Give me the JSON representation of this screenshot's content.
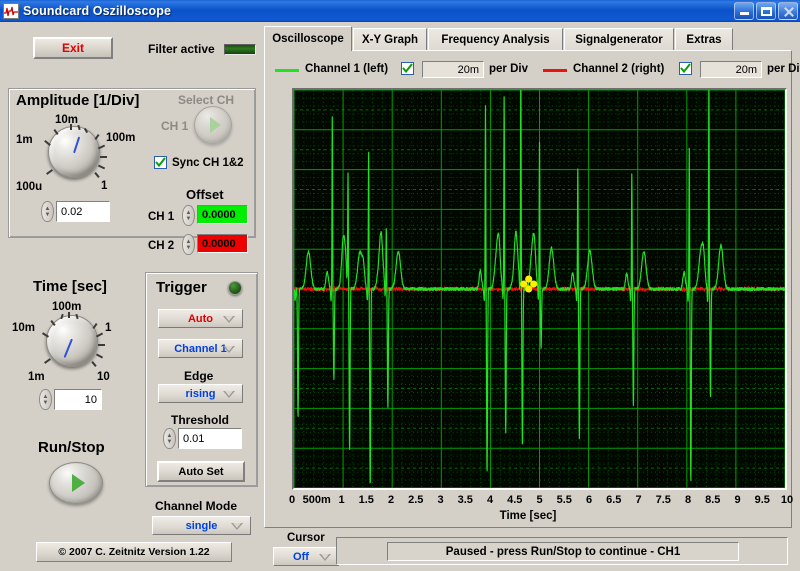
{
  "window": {
    "title": "Soundcard Oszilloscope",
    "icon": "waveform-icon",
    "buttons": {
      "minimize": "minimize-icon",
      "maximize": "maximize-icon",
      "close": "close-icon"
    }
  },
  "toolbar": {
    "exit_label": "Exit",
    "filter_label": "Filter active",
    "filter_state": "off"
  },
  "amplitude": {
    "title": "Amplitude [1/Div]",
    "knob_ticks": [
      "100u",
      "1m",
      "10m",
      "100m",
      "1"
    ],
    "value": "0.02",
    "select_ch_label": "Select CH",
    "ch_label": "CH 1",
    "sync_label": "Sync CH 1&2",
    "sync_checked": true,
    "offset_title": "Offset",
    "offset_ch1_label": "CH 1",
    "offset_ch1_value": "0.0000",
    "offset_ch2_label": "CH 2",
    "offset_ch2_value": "0.0000",
    "colors": {
      "ch1": "#00ee00",
      "ch2": "#ee0000"
    }
  },
  "time": {
    "title": "Time [sec]",
    "knob_ticks": [
      "1m",
      "10m",
      "100m",
      "1",
      "10"
    ],
    "value": "10"
  },
  "trigger": {
    "title": "Trigger",
    "led": "on",
    "mode": "Auto",
    "mode_color": "#e00000",
    "source": "Channel 1",
    "source_color": "#0040e0",
    "edge_label": "Edge",
    "edge": "rising",
    "edge_color": "#0040e0",
    "threshold_label": "Threshold",
    "threshold": "0.01",
    "autoset_label": "Auto Set"
  },
  "run": {
    "label": "Run/Stop"
  },
  "channel_mode": {
    "label": "Channel Mode",
    "value": "single",
    "value_color": "#0040e0"
  },
  "copyright": "© 2007   C. Zeitnitz Version 1.22",
  "tabs": [
    {
      "label": "Oscilloscope",
      "active": true
    },
    {
      "label": "X-Y Graph",
      "active": false
    },
    {
      "label": "Frequency Analysis",
      "active": false
    },
    {
      "label": "Signalgenerator",
      "active": false
    },
    {
      "label": "Extras",
      "active": false
    }
  ],
  "channels": [
    {
      "name": "Channel 1 (left)",
      "color": "#22e022",
      "enabled": true,
      "per_div_value": "20m",
      "per_div_label": "per Div"
    },
    {
      "name": "Channel 2 (right)",
      "color": "#ee1111",
      "enabled": true,
      "per_div_value": "20m",
      "per_div_label": "per Div"
    }
  ],
  "cursor": {
    "label": "Cursor",
    "value": "Off",
    "value_color": "#0040e0"
  },
  "status": {
    "message": "Paused - press Run/Stop to continue - CH1"
  },
  "chart_data": {
    "type": "line",
    "title": "",
    "xlabel": "Time [sec]",
    "ylabel": "",
    "xlim": [
      0,
      10
    ],
    "ylim": [
      -0.2,
      0.2
    ],
    "grid": true,
    "major_divisions_x": 10,
    "major_divisions_y": 10,
    "background": "#000800",
    "grid_major_color": "#00a000",
    "grid_minor_color": "#005000",
    "xticks": [
      "0",
      "500m",
      "1",
      "1.5",
      "2",
      "2.5",
      "3",
      "3.5",
      "4",
      "4.5",
      "5",
      "5.5",
      "6",
      "6.5",
      "7",
      "7.5",
      "8",
      "8.5",
      "9",
      "9.5",
      "10"
    ],
    "cursor_marker": {
      "x": 4.78,
      "y": 0.005,
      "color": "#ffee00"
    },
    "series": [
      {
        "name": "Channel 1 (left)",
        "color": "#22e022",
        "baseline": 0.0,
        "description": "ECG-like pulse train, QRS complexes with tall positive spikes and deep negative undershoots",
        "beats": [
          {
            "t": 0.05,
            "r": 0.0,
            "s": -0.13,
            "q": 0.03
          },
          {
            "t": 0.78,
            "r": 0.175,
            "s": -0.092,
            "q": 0.035
          },
          {
            "t": 1.1,
            "r": 0.105,
            "s": -0.165,
            "q": 0.03
          },
          {
            "t": 1.52,
            "r": 0.14,
            "s": -0.2,
            "q": 0.034
          },
          {
            "t": 1.88,
            "r": 0.06,
            "s": -0.12,
            "q": 0.03
          },
          {
            "t": 3.9,
            "r": 0.185,
            "s": -0.185,
            "q": 0.036
          },
          {
            "t": 4.28,
            "r": 0.195,
            "s": -0.145,
            "q": 0.032
          },
          {
            "t": 4.62,
            "r": 0.225,
            "s": -0.16,
            "q": 0.036
          },
          {
            "t": 5.0,
            "r": 0.148,
            "s": -0.06,
            "q": 0.033
          },
          {
            "t": 5.78,
            "r": 0.122,
            "s": -0.152,
            "q": 0.031
          },
          {
            "t": 6.88,
            "r": 0.118,
            "s": -0.118,
            "q": 0.03
          },
          {
            "t": 8.05,
            "r": 0.14,
            "s": -0.195,
            "q": 0.033
          },
          {
            "t": 8.45,
            "r": 0.215,
            "s": -0.108,
            "q": 0.035
          }
        ]
      },
      {
        "name": "Channel 2 (right)",
        "color": "#ee1111",
        "baseline": 0.0,
        "description": "near-flat baseline with small noise, hidden mostly behind channel 1"
      }
    ]
  }
}
